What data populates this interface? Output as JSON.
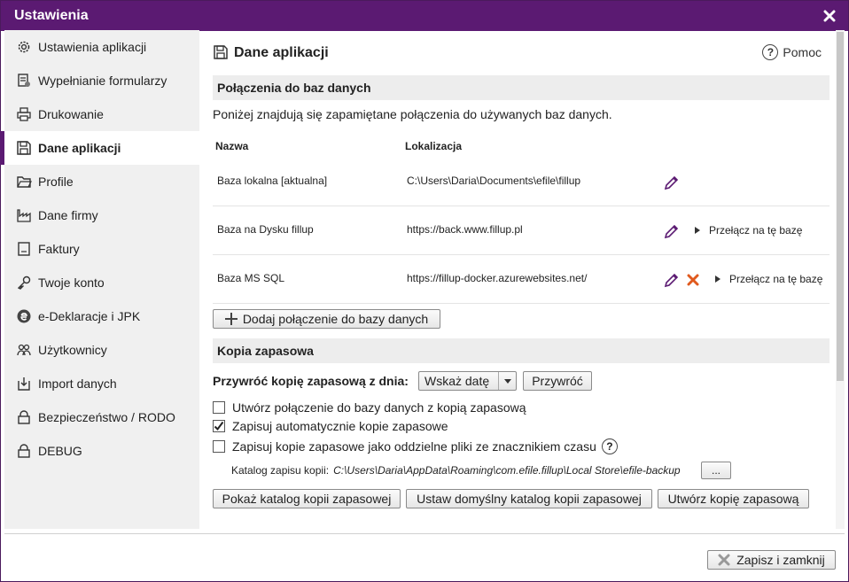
{
  "window": {
    "title": "Ustawienia"
  },
  "sidebar": {
    "items": [
      {
        "label": "Ustawienia aplikacji",
        "icon": "gear-icon"
      },
      {
        "label": "Wypełnianie formularzy",
        "icon": "form-fill-icon"
      },
      {
        "label": "Drukowanie",
        "icon": "printer-icon"
      },
      {
        "label": "Dane aplikacji",
        "icon": "save-disk-icon",
        "active": true
      },
      {
        "label": "Profile",
        "icon": "folder-icon"
      },
      {
        "label": "Dane firmy",
        "icon": "factory-icon"
      },
      {
        "label": "Faktury",
        "icon": "invoice-icon"
      },
      {
        "label": "Twoje konto",
        "icon": "key-icon"
      },
      {
        "label": "e-Deklaracje i JPK",
        "icon": "e-declaration-icon"
      },
      {
        "label": "Użytkownicy",
        "icon": "users-icon"
      },
      {
        "label": "Import danych",
        "icon": "import-icon"
      },
      {
        "label": "Bezpieczeństwo / RODO",
        "icon": "lock-icon"
      },
      {
        "label": "DEBUG",
        "icon": "lock-icon"
      }
    ]
  },
  "main": {
    "title": "Dane aplikacji",
    "help_label": "Pomoc",
    "help_glyph": "?",
    "connections": {
      "section_title": "Połączenia do baz danych",
      "description": "Poniżej znajdują się zapamiętane połączenia do używanych baz danych.",
      "columns": [
        "Nazwa",
        "Lokalizacja"
      ],
      "rows": [
        {
          "name": "Baza lokalna [aktualna]",
          "location": "C:\\Users\\Daria\\Documents\\efile\\fillup",
          "switch_label": ""
        },
        {
          "name": "Baza na Dysku fillup",
          "location": "https://back.www.fillup.pl",
          "switch_label": "Przełącz na tę bazę"
        },
        {
          "name": "Baza MS SQL",
          "location": "https://fillup-docker.azurewebsites.net/",
          "switch_label": "Przełącz na tę bazę"
        }
      ],
      "add_button": "Dodaj połączenie do bazy danych"
    },
    "backup": {
      "section_title": "Kopia zapasowa",
      "restore_label": "Przywróć kopię zapasową z dnia:",
      "date_select_value": "Wskaż datę",
      "restore_button": "Przywróć",
      "checkboxes": [
        {
          "label": "Utwórz połączenie do bazy danych z kopią zapasową",
          "checked": false
        },
        {
          "label": "Zapisuj automatycznie kopie zapasowe",
          "checked": true
        },
        {
          "label": "Zapisuj kopie zapasowe jako oddzielne pliki ze znacznikiem czasu",
          "checked": false
        }
      ],
      "catalog_label": "Katalog zapisu kopii:",
      "catalog_path": "C:\\Users\\Daria\\AppData\\Roaming\\com.efile.fillup\\Local Store\\efile-backup",
      "browse_button": "...",
      "show_catalog_button": "Pokaż katalog kopii zapasowej",
      "default_catalog_button": "Ustaw domyślny katalog kopii zapasowej",
      "create_backup_button": "Utwórz kopię zapasową"
    }
  },
  "footer": {
    "save_close_button": "Zapisz i zamknij"
  },
  "colors": {
    "accent": "#5b1a72",
    "delete": "#e05a1e"
  }
}
